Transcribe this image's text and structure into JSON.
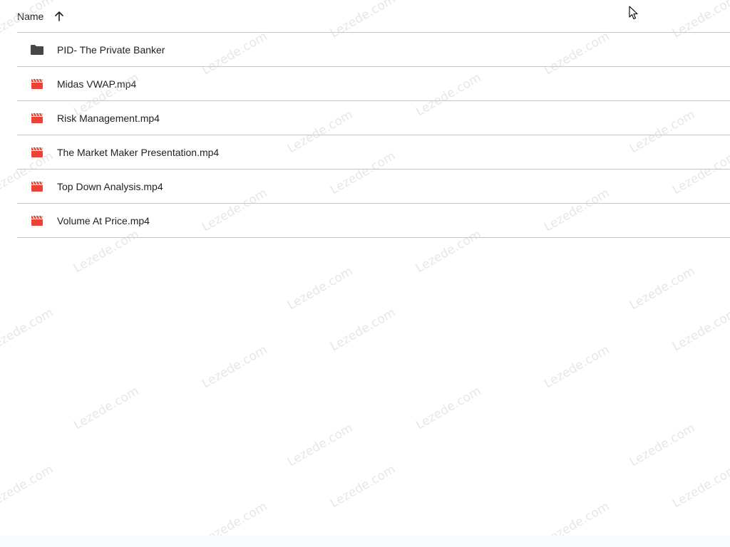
{
  "list": {
    "header": {
      "name_label": "Name",
      "sort_icon": "arrow-up-icon"
    },
    "items": [
      {
        "name": "PID- The Private Banker",
        "icon": "folder-icon",
        "color": "#444746"
      },
      {
        "name": "Midas VWAP.mp4",
        "icon": "video-icon",
        "color": "#ea4335"
      },
      {
        "name": "Risk Management.mp4",
        "icon": "video-icon",
        "color": "#ea4335"
      },
      {
        "name": "The Market Maker Presentation.mp4",
        "icon": "video-icon",
        "color": "#ea4335"
      },
      {
        "name": "Top Down Analysis.mp4",
        "icon": "video-icon",
        "color": "#ea4335"
      },
      {
        "name": "Volume At Price.mp4",
        "icon": "video-icon",
        "color": "#ea4335"
      }
    ]
  },
  "watermark": {
    "text": "Lezede.com"
  },
  "cursor": {
    "icon": "mouse-pointer-icon"
  }
}
